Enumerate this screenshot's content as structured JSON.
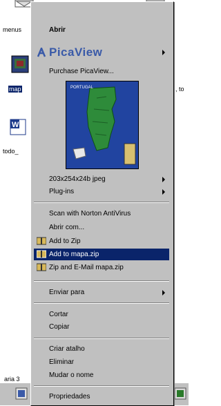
{
  "desktop": {
    "labels": {
      "menus": "menus",
      "mapa": "map",
      "todo": "todo_",
      "right_text": ", to",
      "bottom_left": "aria 3"
    }
  },
  "menu": {
    "header": "Abrir",
    "picaview": {
      "label": "PicaView",
      "color": "#3a5aa8"
    },
    "purchase": "Purchase PicaView...",
    "thumbnail": {
      "map_title": "PORTUGAL"
    },
    "image_info": "203x254x24b jpeg",
    "plugins": "Plug-ins",
    "scan": "Scan with Norton AntiVirus",
    "open_with": "Abrir com...",
    "add_to_zip": "Add to Zip",
    "add_to_mapa_zip": "Add to mapa.zip",
    "zip_email": "Zip and E-Mail mapa.zip",
    "send_to": "Enviar para",
    "cut": "Cortar",
    "copy": "Copiar",
    "create_shortcut": "Criar atalho",
    "delete": "Eliminar",
    "rename": "Mudar o nome",
    "properties": "Propriedades",
    "highlight_color": "#0a246a"
  }
}
